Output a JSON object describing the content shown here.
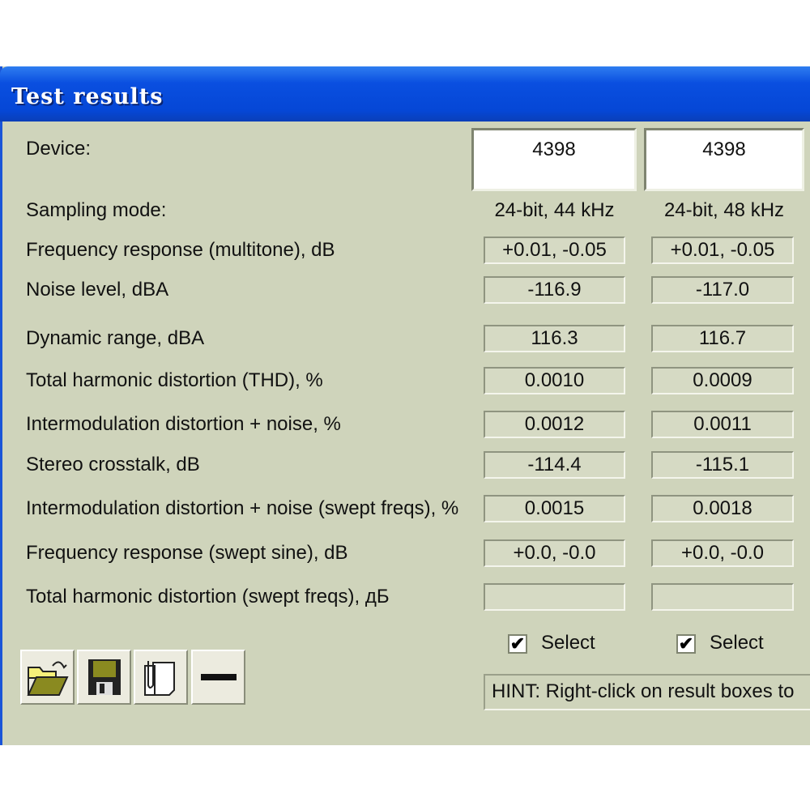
{
  "window": {
    "title": "Test results"
  },
  "device": {
    "label": "Device:",
    "values": [
      "4398",
      "4398"
    ]
  },
  "sampling": {
    "label": "Sampling mode:",
    "values": [
      "24-bit, 44 kHz",
      "24-bit, 48 kHz"
    ]
  },
  "rows": [
    {
      "label": "Frequency response (multitone), dB",
      "values": [
        "+0.01, -0.05",
        "+0.01, -0.05"
      ]
    },
    {
      "label": "Noise level, dBA",
      "values": [
        "-116.9",
        "-117.0"
      ]
    },
    {
      "label": "Dynamic range, dBA",
      "values": [
        "116.3",
        "116.7"
      ]
    },
    {
      "label": "Total harmonic distortion (THD), %",
      "values": [
        "0.0010",
        "0.0009"
      ]
    },
    {
      "label": "Intermodulation distortion + noise, %",
      "values": [
        "0.0012",
        "0.0011"
      ]
    },
    {
      "label": "Stereo crosstalk, dB",
      "values": [
        "-114.4",
        "-115.1"
      ]
    },
    {
      "label": "Intermodulation distortion + noise (swept freqs), %",
      "values": [
        "0.0015",
        "0.0018"
      ]
    },
    {
      "label": "Frequency response (swept sine), dB",
      "values": [
        "+0.0, -0.0",
        "+0.0, -0.0"
      ]
    },
    {
      "label": "Total harmonic distortion (swept freqs), дБ",
      "values": [
        "",
        ""
      ]
    }
  ],
  "select": {
    "label": "Select",
    "checked": [
      true,
      true
    ],
    "mark": "✔"
  },
  "hint": "HINT: Right-click on result boxes to",
  "toolbar": {
    "icons": [
      "open-folder-icon",
      "save-floppy-icon",
      "copy-clipboard-icon",
      "minus-icon"
    ]
  }
}
